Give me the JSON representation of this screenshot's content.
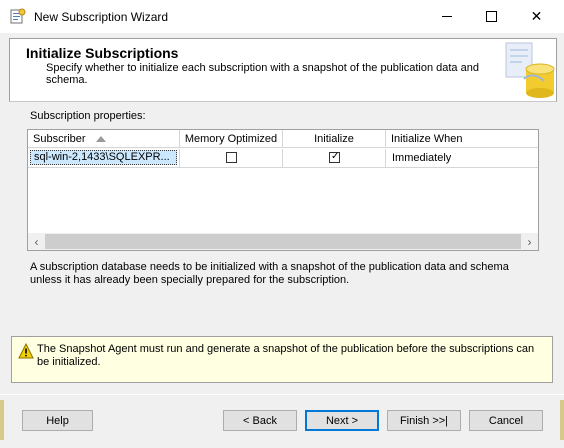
{
  "window": {
    "title": "New Subscription Wizard",
    "icon": "wizard-app-icon",
    "controls": [
      "minimize-icon",
      "maximize-icon",
      "close-icon"
    ]
  },
  "header": {
    "title": "Initialize Subscriptions",
    "subtitle": "Specify whether to initialize each subscription with a snapshot of the publication data and schema."
  },
  "properties": {
    "label": "Subscription properties:",
    "columns": [
      "Subscriber",
      "Memory Optimized",
      "Initialize",
      "Initialize When"
    ],
    "rows": [
      {
        "subscriber": "sql-win-2,1433\\SQLEXPR...",
        "memory_optimized": false,
        "initialize": true,
        "initialize_when": "Immediately"
      }
    ]
  },
  "description": "A subscription database needs to be initialized with a snapshot of the publication data and schema unless it has already been specially prepared for the subscription.",
  "warning": {
    "icon": "warning-icon",
    "text": "The Snapshot Agent must run and generate a snapshot of the publication before the subscriptions can be initialized."
  },
  "buttons": {
    "help": "Help",
    "back": "< Back",
    "next": "Next >",
    "finish": "Finish >>|",
    "cancel": "Cancel"
  },
  "colors": {
    "selection": "#cce8ff",
    "warning_bg": "#ffffe1",
    "default_button_border": "#0078d7"
  }
}
